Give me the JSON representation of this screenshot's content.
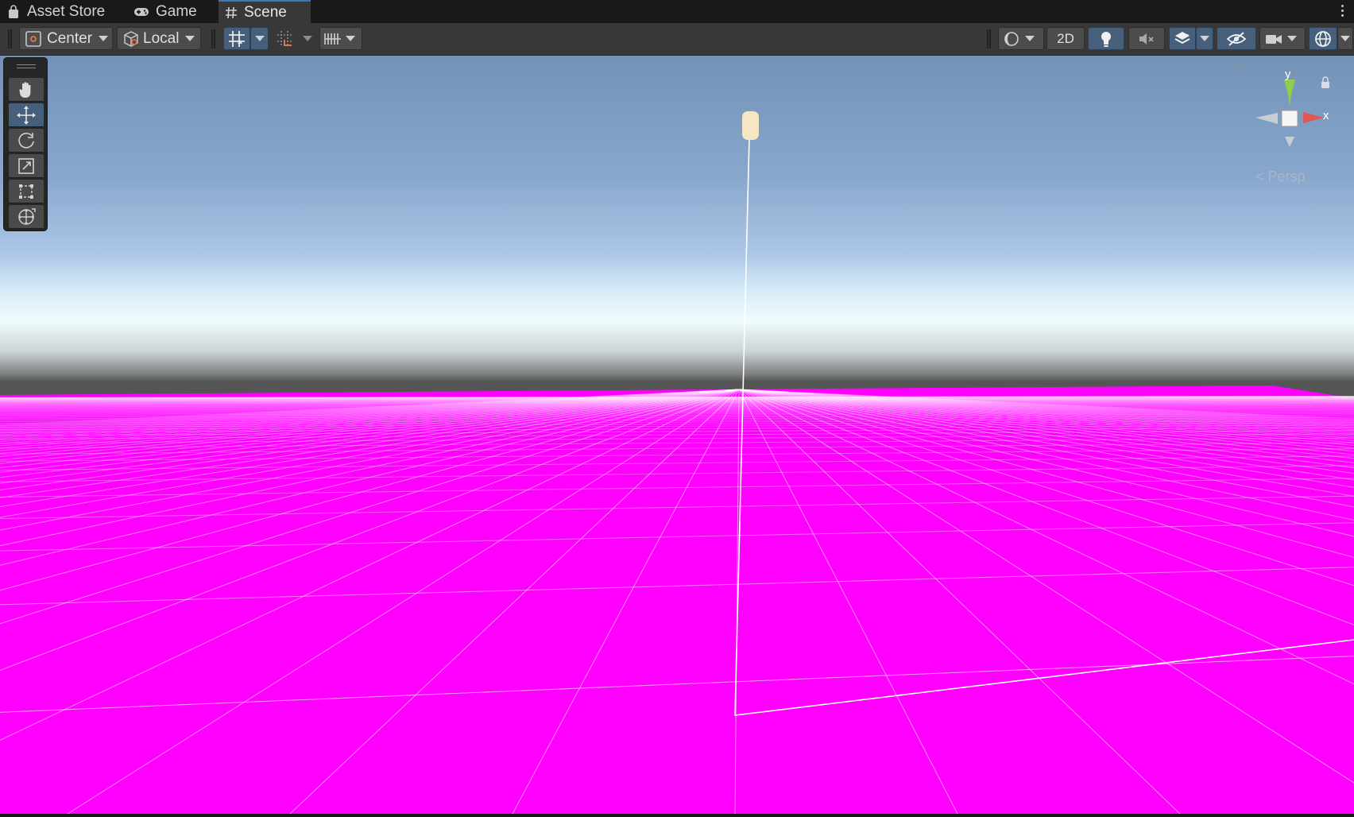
{
  "tabs": [
    {
      "label": "Asset Store",
      "icon": "shopping-bag-icon",
      "active": false
    },
    {
      "label": "Game",
      "icon": "gamepad-icon",
      "active": false
    },
    {
      "label": "Scene",
      "icon": "hash-icon",
      "active": true
    }
  ],
  "toolbar": {
    "pivot_mode": "Center",
    "pivot_rotation": "Local",
    "two_d_label": "2D"
  },
  "tools": [
    {
      "name": "hand-tool",
      "icon": "hand-icon",
      "active": false
    },
    {
      "name": "move-tool",
      "icon": "move-arrows-icon",
      "active": true
    },
    {
      "name": "rotate-tool",
      "icon": "rotate-icon",
      "active": false
    },
    {
      "name": "scale-tool",
      "icon": "scale-icon",
      "active": false
    },
    {
      "name": "rect-tool",
      "icon": "rect-transform-icon",
      "active": false
    },
    {
      "name": "transform-tool",
      "icon": "transform-icon",
      "active": false
    }
  ],
  "gizmo": {
    "y_label": "y",
    "x_label": "x",
    "projection_label": "Persp"
  },
  "colors": {
    "ground": "#ff00ff",
    "accent": "#3a79bb",
    "active_button": "#46607c",
    "x_axis": "#e0584f",
    "y_axis": "#8dd440"
  }
}
